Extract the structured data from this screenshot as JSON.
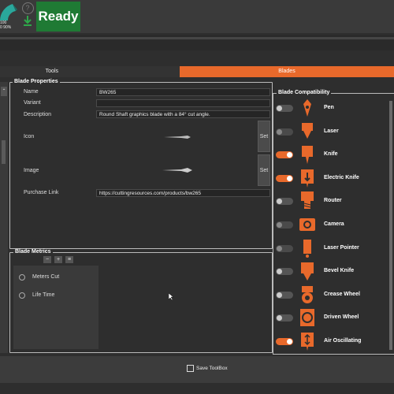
{
  "topbar": {
    "gauge_top": "100",
    "gauge_bottom": "0 90%",
    "help_glyph": "?",
    "status": "Ready",
    "status_color": "#1f7a34"
  },
  "tabs": {
    "tools": "Tools",
    "blades": "Blades",
    "accent": "#e8692b"
  },
  "properties": {
    "title": "Blade Properties",
    "name_label": "Name",
    "name_value": "BW265",
    "variant_label": "Variant",
    "variant_value": "",
    "description_label": "Description",
    "description_value": "Round Shaft graphics blade with a 84° cut angle.",
    "icon_label": "Icon",
    "image_label": "Image",
    "set_label": "Set",
    "purchase_label": "Purchase Link",
    "purchase_value": "https://cuttingresources.com/products/bw265"
  },
  "metrics": {
    "title": "Blade Metrics",
    "items": [
      "Meters Cut",
      "Life Time"
    ],
    "buttons": [
      "−",
      "+",
      "≡"
    ]
  },
  "compat": {
    "title": "Blade Compatibility",
    "tools": [
      {
        "label": "Pen",
        "state": "off",
        "icon": "pen-icon"
      },
      {
        "label": "Laser",
        "state": "disabled",
        "icon": "laser-icon"
      },
      {
        "label": "Knife",
        "state": "on",
        "icon": "knife-icon"
      },
      {
        "label": "Electric Knife",
        "state": "on",
        "icon": "electric-knife-icon"
      },
      {
        "label": "Router",
        "state": "off",
        "icon": "router-icon"
      },
      {
        "label": "Camera",
        "state": "disabled",
        "icon": "camera-icon"
      },
      {
        "label": "Laser Pointer",
        "state": "disabled",
        "icon": "laser-pointer-icon"
      },
      {
        "label": "Bevel Knife",
        "state": "off",
        "icon": "bevel-knife-icon"
      },
      {
        "label": "Crease Wheel",
        "state": "off",
        "icon": "crease-wheel-icon"
      },
      {
        "label": "Driven Wheel",
        "state": "off",
        "icon": "driven-wheel-icon"
      },
      {
        "label": "Air Oscillating",
        "state": "on",
        "icon": "air-oscillating-icon"
      }
    ]
  },
  "footer": {
    "save_label": "Save ToolBox"
  }
}
